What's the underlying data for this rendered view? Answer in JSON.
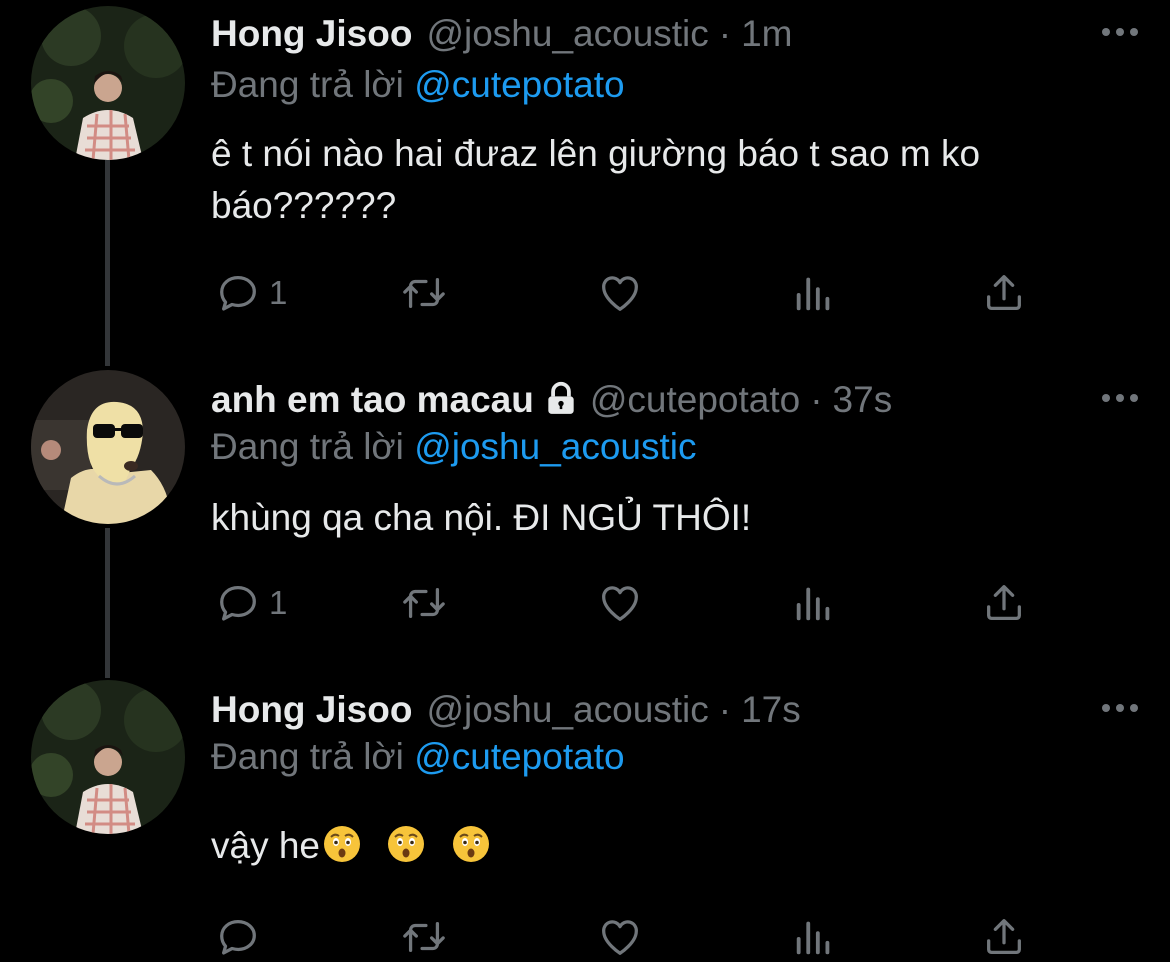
{
  "colors": {
    "background": "#000000",
    "text": "#e7e9ea",
    "muted": "#71767b",
    "link": "#1d9bf0",
    "thread_line": "#333639"
  },
  "tweets": [
    {
      "name": "Hong Jisoo",
      "handle": "@joshu_acoustic",
      "separator": "·",
      "time": "1m",
      "reply_prefix": "Đang trả lời",
      "reply_to": "@cutepotato",
      "text": "ê t nói nào hai đưaz lên giường báo t sao m ko báo??????",
      "reply_count": "1",
      "icons": [
        "more-icon",
        "reply-icon",
        "retweet-icon",
        "like-icon",
        "analytics-icon",
        "share-icon"
      ]
    },
    {
      "name": "anh em tao macau",
      "locked": true,
      "handle": "@cutepotato",
      "separator": "·",
      "time": "37s",
      "reply_prefix": "Đang trả lời",
      "reply_to": "@joshu_acoustic",
      "text": "khùng qa cha nội. ĐI NGỦ THÔI!",
      "reply_count": "1",
      "icons": [
        "lock-icon",
        "more-icon",
        "reply-icon",
        "retweet-icon",
        "like-icon",
        "analytics-icon",
        "share-icon"
      ]
    },
    {
      "name": "Hong Jisoo",
      "handle": "@joshu_acoustic",
      "separator": "·",
      "time": "17s",
      "reply_prefix": "Đang trả lời",
      "reply_to": "@cutepotato",
      "text": "vậy he",
      "emojis": "astonished-face x3",
      "reply_count": "",
      "icons": [
        "more-icon",
        "reply-icon",
        "retweet-icon",
        "like-icon",
        "analytics-icon",
        "share-icon"
      ]
    }
  ]
}
